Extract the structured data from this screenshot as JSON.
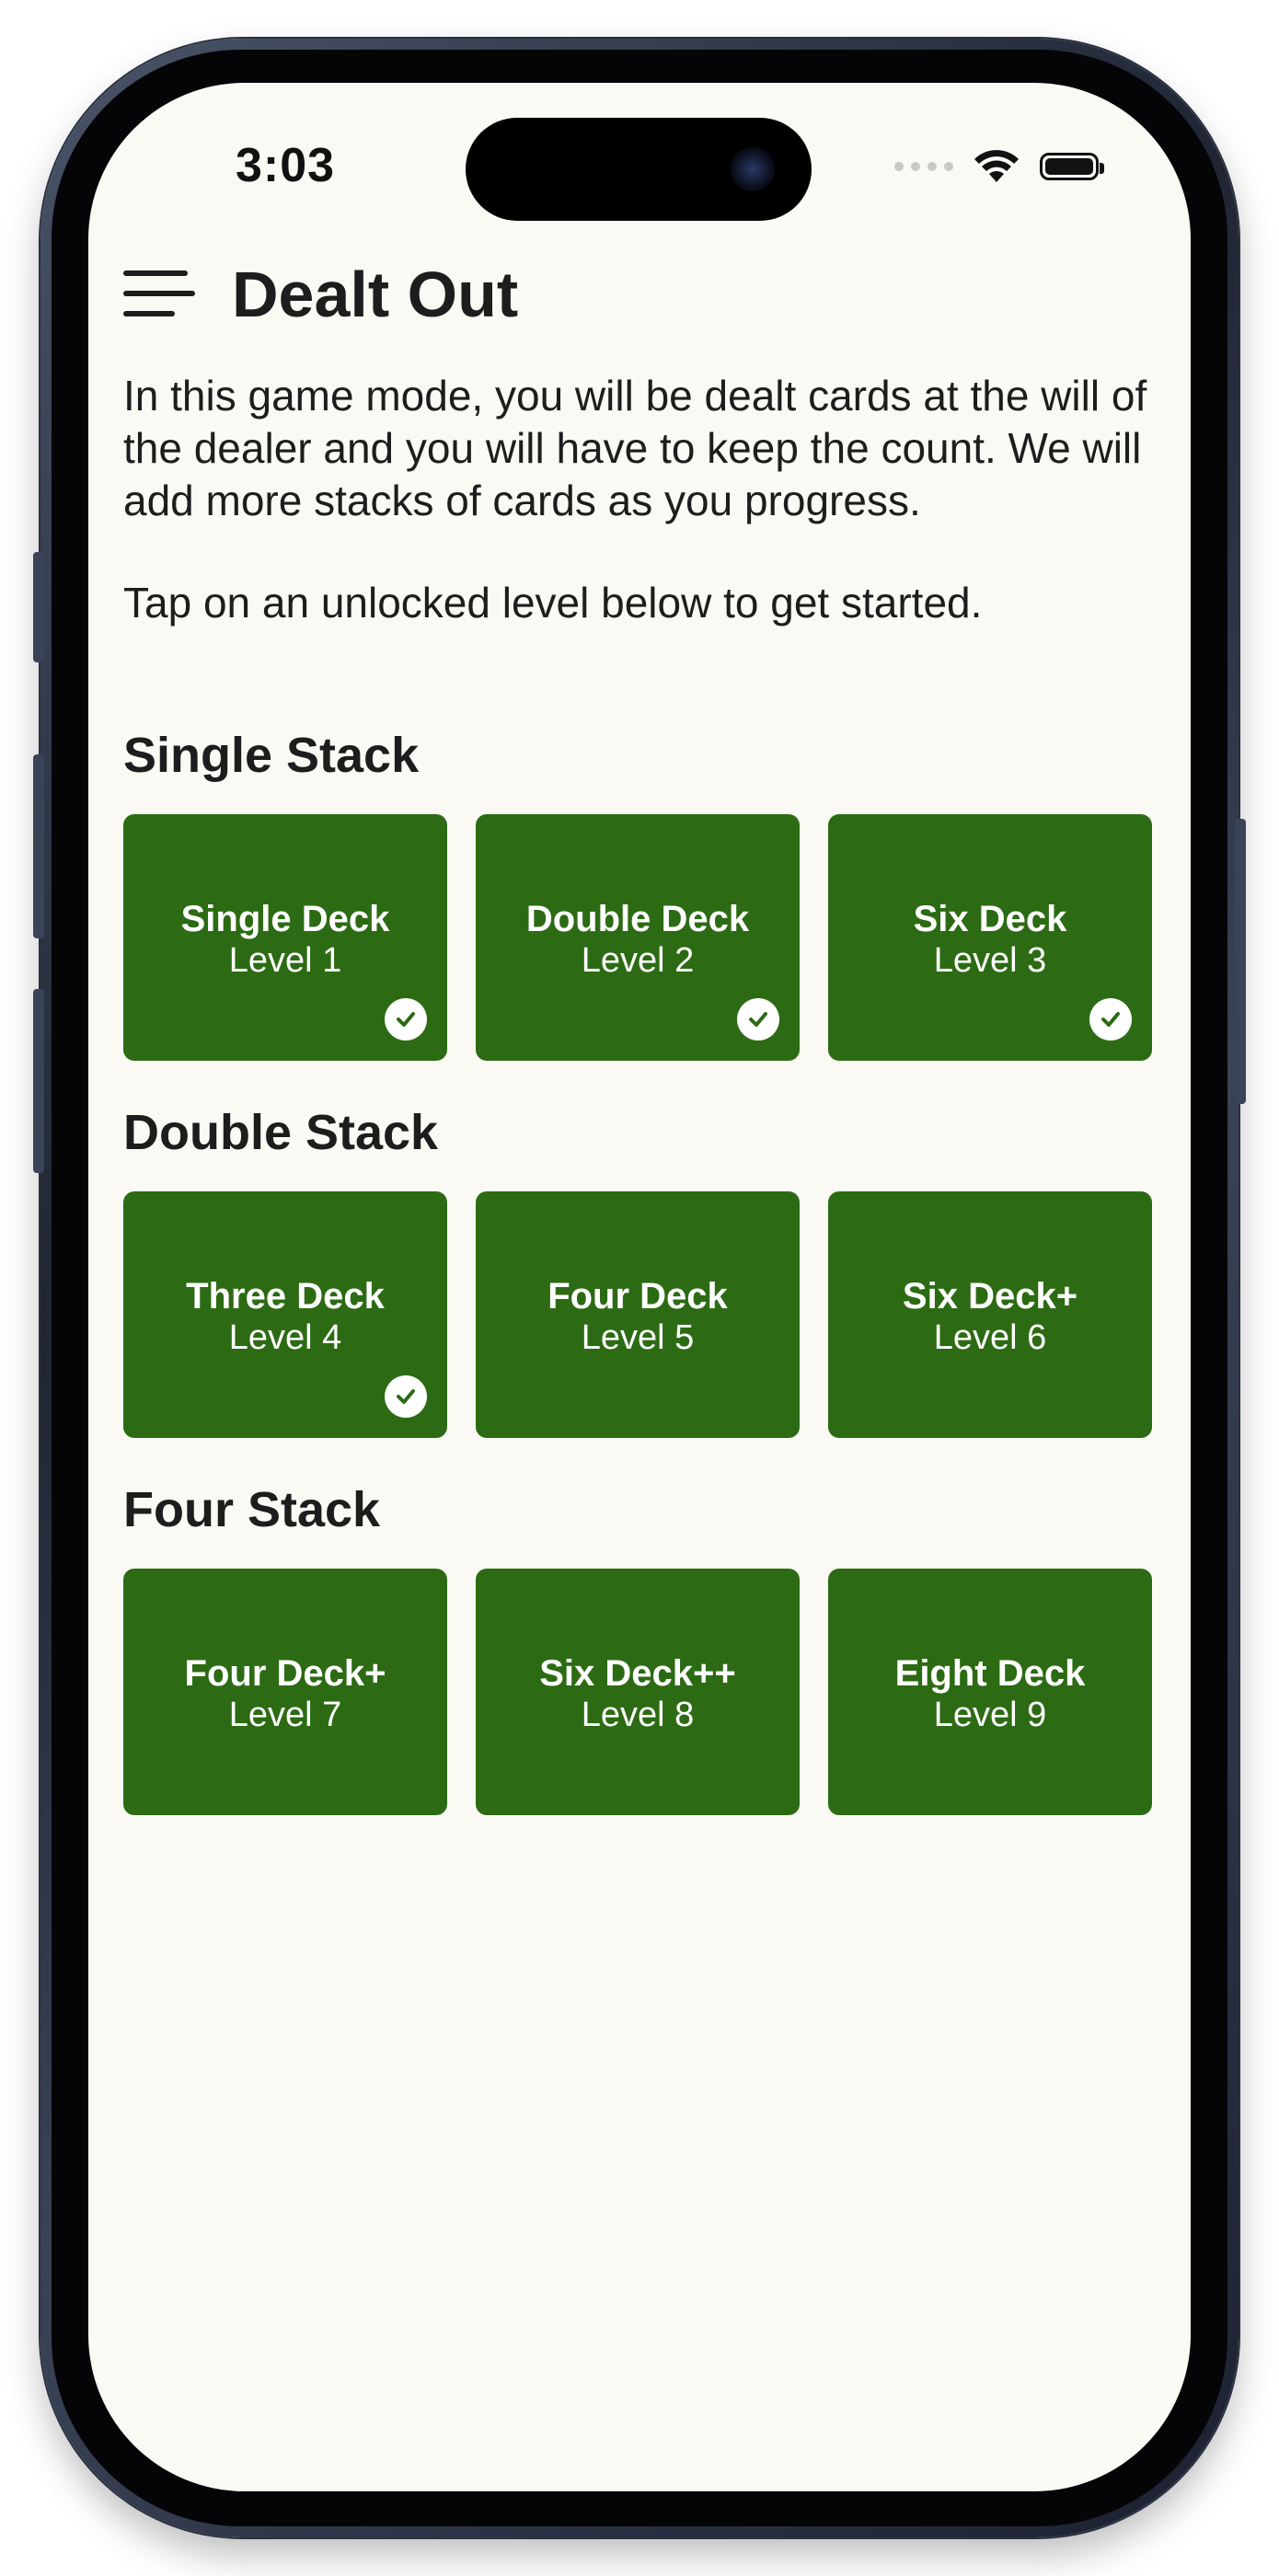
{
  "status_bar": {
    "time": "3:03"
  },
  "header": {
    "title": "Dealt Out"
  },
  "intro": {
    "paragraph1": "In this game mode, you will be dealt cards at the will of the dealer and you will have to keep the count. We will add more stacks of cards as you progress.",
    "paragraph2": "Tap on an unlocked level below to get started."
  },
  "sections": [
    {
      "title": "Single Stack",
      "levels": [
        {
          "name": "Single Deck",
          "level": "Level 1",
          "completed": true
        },
        {
          "name": "Double Deck",
          "level": "Level 2",
          "completed": true
        },
        {
          "name": "Six Deck",
          "level": "Level 3",
          "completed": true
        }
      ]
    },
    {
      "title": "Double Stack",
      "levels": [
        {
          "name": "Three Deck",
          "level": "Level 4",
          "completed": true
        },
        {
          "name": "Four Deck",
          "level": "Level 5",
          "completed": false
        },
        {
          "name": "Six Deck+",
          "level": "Level 6",
          "completed": false
        }
      ]
    },
    {
      "title": "Four Stack",
      "levels": [
        {
          "name": "Four Deck+",
          "level": "Level 7",
          "completed": false
        },
        {
          "name": "Six Deck++",
          "level": "Level 8",
          "completed": false
        },
        {
          "name": "Eight Deck",
          "level": "Level 9",
          "completed": false
        }
      ]
    }
  ],
  "colors": {
    "background": "#faf9f3",
    "card": "#2c6b13",
    "text": "#1d1d1d"
  },
  "icons": {
    "menu": "menu-icon",
    "completed": "checkmark-circle-icon",
    "wifi": "wifi-icon",
    "battery": "battery-icon",
    "signal": "cellular-signal-icon"
  }
}
